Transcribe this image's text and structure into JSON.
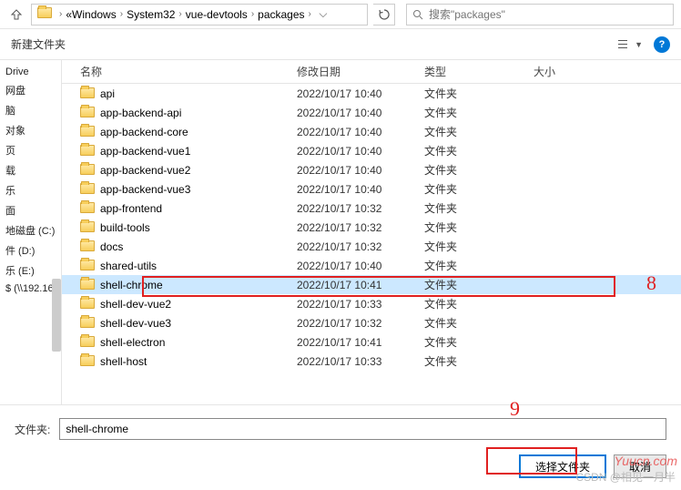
{
  "breadcrumb": [
    "Windows",
    "System32",
    "vue-devtools",
    "packages"
  ],
  "search": {
    "placeholder": "搜索\"packages\""
  },
  "toolbar": {
    "new_folder": "新建文件夹"
  },
  "sidebar": {
    "items": [
      "Drive",
      "网盘",
      "脑",
      "对象",
      "页",
      "载",
      "乐",
      "面",
      "地磁盘 (C:)",
      "件 (D:)",
      "乐 (E:)",
      "$ (\\\\192.16"
    ]
  },
  "headers": {
    "name": "名称",
    "date": "修改日期",
    "type": "类型",
    "size": "大小"
  },
  "rows": [
    {
      "name": "api",
      "date": "2022/10/17 10:40",
      "type": "文件夹"
    },
    {
      "name": "app-backend-api",
      "date": "2022/10/17 10:40",
      "type": "文件夹"
    },
    {
      "name": "app-backend-core",
      "date": "2022/10/17 10:40",
      "type": "文件夹"
    },
    {
      "name": "app-backend-vue1",
      "date": "2022/10/17 10:40",
      "type": "文件夹"
    },
    {
      "name": "app-backend-vue2",
      "date": "2022/10/17 10:40",
      "type": "文件夹"
    },
    {
      "name": "app-backend-vue3",
      "date": "2022/10/17 10:40",
      "type": "文件夹"
    },
    {
      "name": "app-frontend",
      "date": "2022/10/17 10:32",
      "type": "文件夹"
    },
    {
      "name": "build-tools",
      "date": "2022/10/17 10:32",
      "type": "文件夹"
    },
    {
      "name": "docs",
      "date": "2022/10/17 10:32",
      "type": "文件夹"
    },
    {
      "name": "shared-utils",
      "date": "2022/10/17 10:40",
      "type": "文件夹"
    },
    {
      "name": "shell-chrome",
      "date": "2022/10/17 10:41",
      "type": "文件夹",
      "selected": true
    },
    {
      "name": "shell-dev-vue2",
      "date": "2022/10/17 10:33",
      "type": "文件夹"
    },
    {
      "name": "shell-dev-vue3",
      "date": "2022/10/17 10:32",
      "type": "文件夹"
    },
    {
      "name": "shell-electron",
      "date": "2022/10/17 10:41",
      "type": "文件夹"
    },
    {
      "name": "shell-host",
      "date": "2022/10/17 10:33",
      "type": "文件夹"
    }
  ],
  "footer": {
    "folder_label": "文件夹:",
    "folder_value": "shell-chrome",
    "select_btn": "选择文件夹",
    "cancel_btn": "取消"
  },
  "annotations": {
    "eight": "8",
    "nine": "9"
  },
  "watermark": {
    "w1": "Yuucn.com",
    "w2": "CSDN @相见一月半"
  }
}
